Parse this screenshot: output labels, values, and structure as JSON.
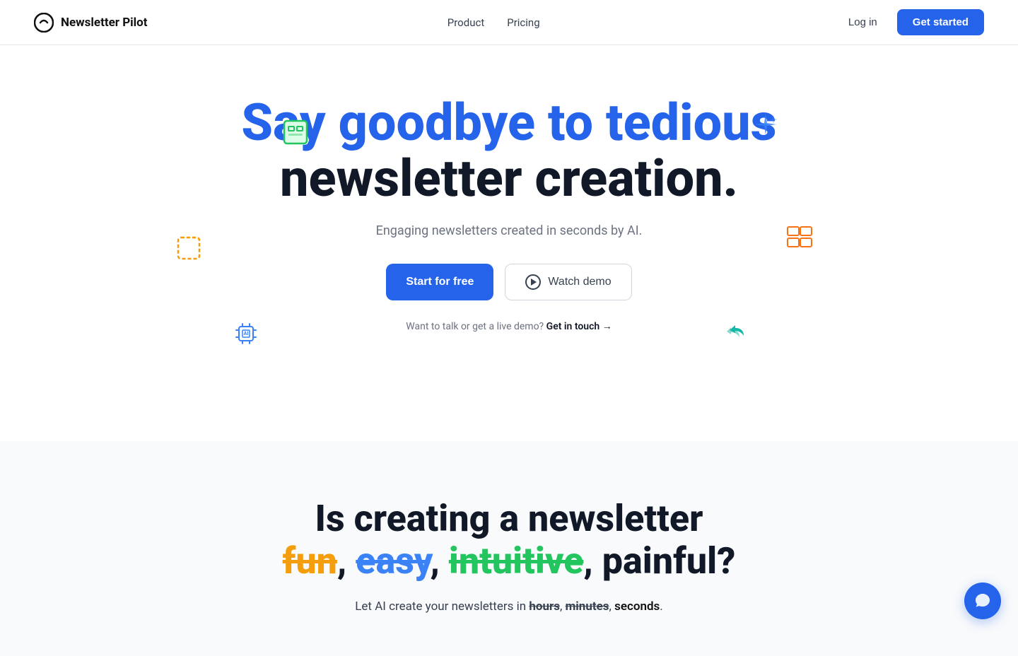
{
  "nav": {
    "logo_text": "Newsletter Pilot",
    "links": [
      {
        "label": "Product",
        "id": "product"
      },
      {
        "label": "Pricing",
        "id": "pricing"
      }
    ],
    "login_label": "Log in",
    "get_started_label": "Get started"
  },
  "hero": {
    "title_line1": "Say goodbye to tedious",
    "title_line2": "newsletter creation.",
    "subtitle": "Engaging newsletters created in seconds by AI.",
    "btn_start": "Start for free",
    "btn_watch": "Watch demo",
    "contact_text": "Want to talk or get a live demo?",
    "contact_link": "Get in touch →"
  },
  "section2": {
    "title_line1": "Is creating a newsletter",
    "word_fun": "fun",
    "word_easy": "easy",
    "word_intuitive": "intuitive",
    "word_painful": "painful?",
    "sub_prefix": "Let AI create your newsletters in ",
    "word_hours": "hours",
    "word_minutes": "minutes",
    "word_seconds": "seconds",
    "sub_suffix": "."
  }
}
